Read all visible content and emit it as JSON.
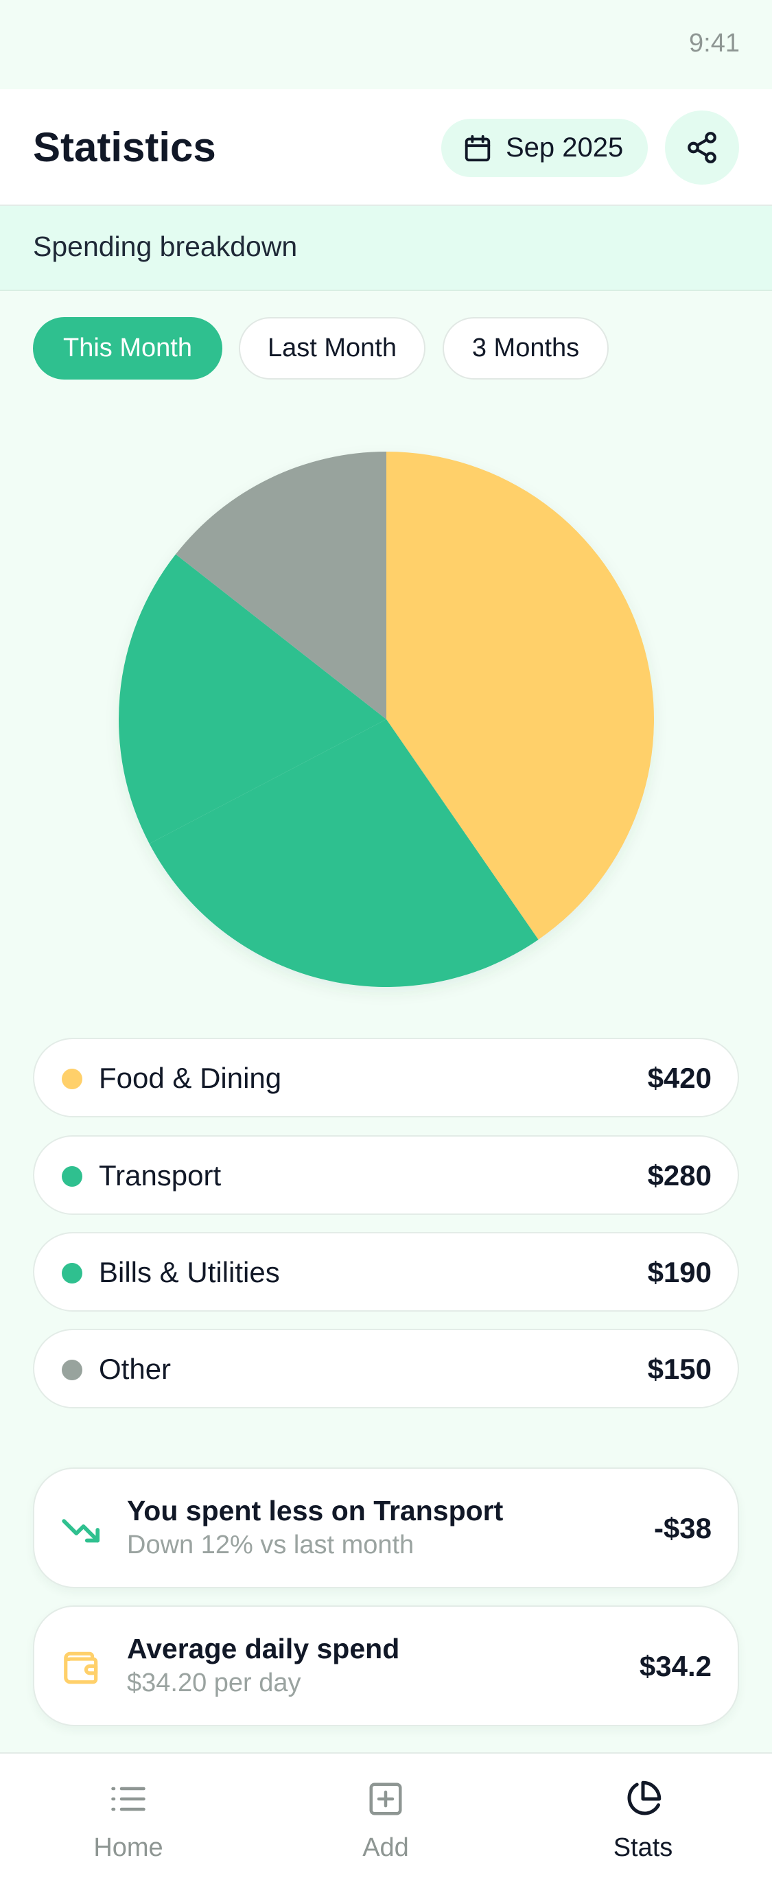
{
  "status_bar": {
    "time": "9:41"
  },
  "header": {
    "title": "Statistics",
    "date_label": "Sep 2025",
    "calendar_icon": "calendar-icon",
    "share_icon": "share-icon"
  },
  "subheader": {
    "text": "Spending breakdown"
  },
  "tabs": [
    {
      "label": "This Month",
      "active": true
    },
    {
      "label": "Last Month",
      "active": false
    },
    {
      "label": "3 Months",
      "active": false
    }
  ],
  "chart_data": {
    "type": "pie",
    "slices": [
      {
        "label": "Food & Dining",
        "value": 420,
        "color": "#ffd06a"
      },
      {
        "label": "Transport",
        "value": 280,
        "color": "#2fc08f"
      },
      {
        "label": "Bills & Utilities",
        "value": 190,
        "color": "#2fc08f"
      },
      {
        "label": "Other",
        "value": 150,
        "color": "#98a39d"
      }
    ]
  },
  "legend": [
    {
      "label": "Food & Dining",
      "value": "$420",
      "color": "#ffd06a"
    },
    {
      "label": "Transport",
      "value": "$280",
      "color": "#2fc08f"
    },
    {
      "label": "Bills & Utilities",
      "value": "$190",
      "color": "#2fc08f"
    },
    {
      "label": "Other",
      "value": "$150",
      "color": "#98a39d"
    }
  ],
  "insights": [
    {
      "icon": "trending-down-icon",
      "title": "You spent less on Transport",
      "subtitle": "Down 12% vs last month",
      "value": "-$38",
      "icon_color": "#2fc08f"
    },
    {
      "icon": "wallet-icon",
      "title": "Average daily spend",
      "subtitle": "$34.20 per day",
      "value": "$34.2",
      "icon_color": "#ffd06a"
    }
  ],
  "bottom_nav": [
    {
      "icon": "list-icon",
      "label": "Home",
      "active": false
    },
    {
      "icon": "plus-square-icon",
      "label": "Add",
      "active": false
    },
    {
      "icon": "pie-chart-icon",
      "label": "Stats",
      "active": true
    }
  ],
  "colors": {
    "accent": "#2fc08f",
    "background": "#f2fdf6",
    "muted": "#8e9693"
  }
}
